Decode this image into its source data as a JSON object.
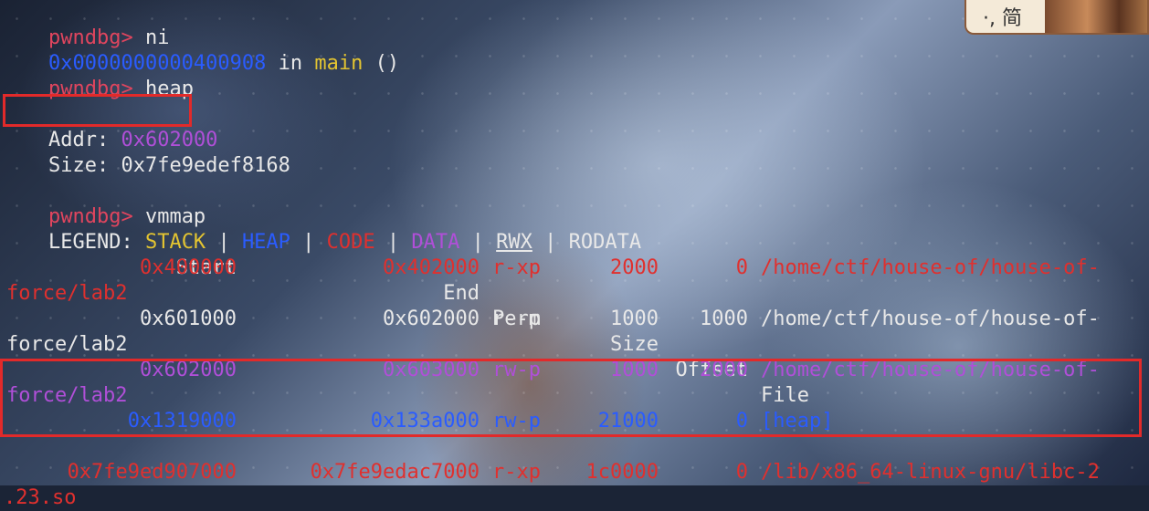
{
  "terminal": {
    "line1": {
      "prompt": "pwndbg>",
      "cmd": "ni"
    },
    "line2": {
      "addr": "0x0000000000400908",
      "in": "in",
      "func": "main",
      "args": "()"
    },
    "line3": {
      "prompt": "pwndbg>",
      "cmd": "heap"
    },
    "heap_addr_label": "Addr:",
    "heap_addr_value": "0x602000",
    "heap_size_label": "Size:",
    "heap_size_value": "0x7fe9edef8168",
    "line7": {
      "prompt": "pwndbg>",
      "cmd": "vmmap"
    },
    "legend": {
      "label": "LEGEND:",
      "stack": "STACK",
      "heap": "HEAP",
      "code": "CODE",
      "data": "DATA",
      "rwx": "RWX",
      "rodata": "RODATA",
      "sep": "|"
    },
    "vmmap_header": {
      "start": "Start",
      "end": "End",
      "perm": "Perm",
      "size": "Size",
      "offset": "Offset",
      "file": "File"
    },
    "vmmap_rows": [
      {
        "start": "0x400000",
        "end": "0x402000",
        "perm": "r-xp",
        "size": "2000",
        "offset": "0",
        "file": "/home/ctf/house-of/house-of-",
        "file_cont": "force/lab2",
        "color": "#e0302e"
      },
      {
        "start": "0x601000",
        "end": "0x602000",
        "perm": "r--p",
        "size": "1000",
        "offset": "1000",
        "file": "/home/ctf/house-of/house-of-",
        "file_cont": "force/lab2",
        "color": "#e8e8e8"
      },
      {
        "start": "0x602000",
        "end": "0x603000",
        "perm": "rw-p",
        "size": "1000",
        "offset": "2000",
        "file": "/home/ctf/house-of/house-of-",
        "file_cont": "force/lab2",
        "color": "#b04fd8"
      },
      {
        "start": "0x1319000",
        "end": "0x133a000",
        "perm": "rw-p",
        "size": "21000",
        "offset": "0",
        "file": "[heap]",
        "file_cont": "",
        "color": "#2a5cff"
      },
      {
        "start": "0x7fe9ed907000",
        "end": "0x7fe9edac7000",
        "perm": "r-xp",
        "size": "1c0000",
        "offset": "0",
        "file": "/lib/x86_64-linux-gnu/libc-2",
        "file_cont": ".23.so",
        "color": "#e0302e"
      }
    ]
  },
  "ime_badge": {
    "text": "·, 简"
  }
}
